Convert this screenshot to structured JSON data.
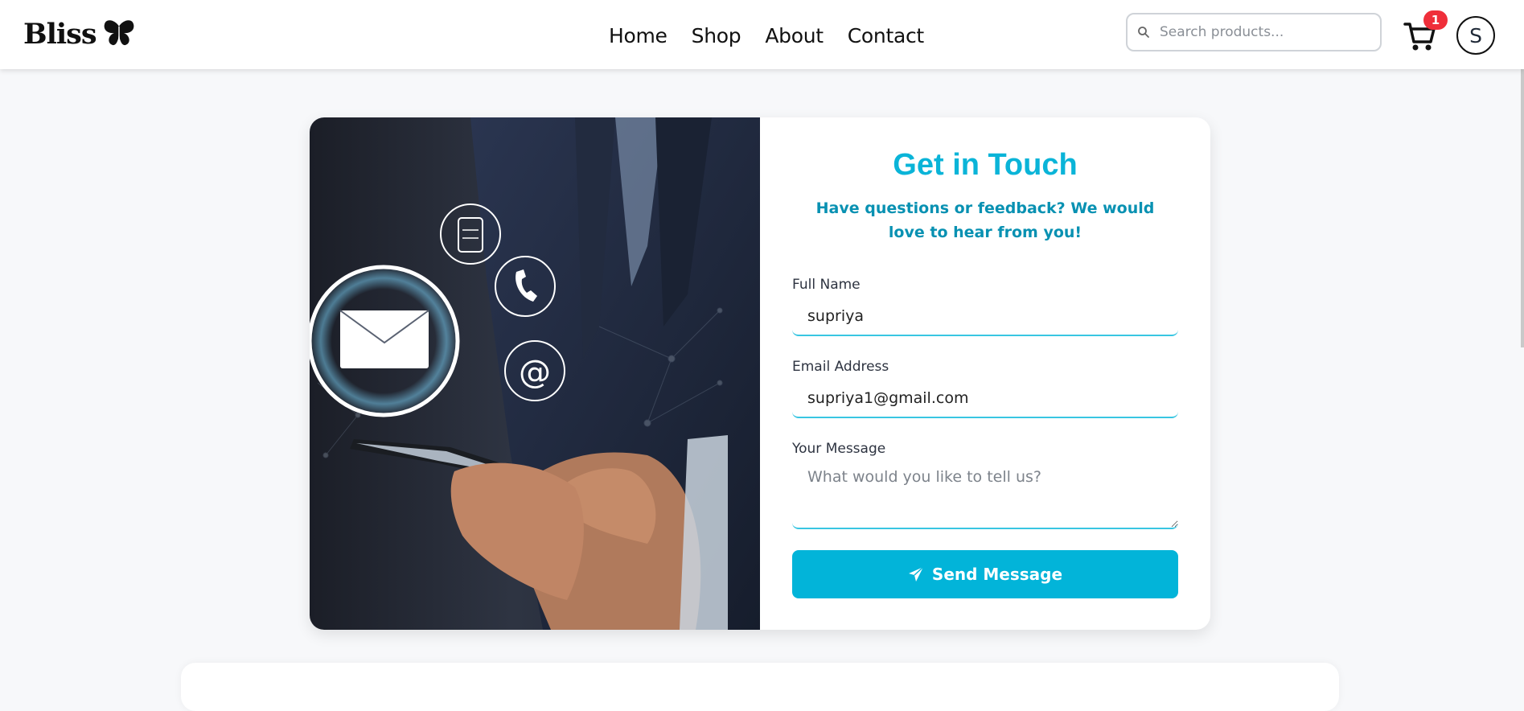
{
  "nav": {
    "brand": "Bliss",
    "links": [
      "Home",
      "Shop",
      "About",
      "Contact"
    ],
    "search_placeholder": "Search products...",
    "cart_count": "1",
    "avatar_letter": "S"
  },
  "contact": {
    "title": "Get in Touch",
    "subtitle": "Have questions or feedback? We would love to hear from you!",
    "name_label": "Full Name",
    "name_value": "supriya",
    "email_label": "Email Address",
    "email_value": "supriya1@gmail.com",
    "message_label": "Your Message",
    "message_placeholder": "What would you like to tell us?",
    "send_label": "Send Message"
  },
  "colors": {
    "accent": "#02b4d9",
    "heading": "#0ab4d8",
    "badge": "#ef2f3a"
  },
  "icons": [
    "butterfly-icon",
    "search-icon",
    "cart-icon",
    "paper-plane-icon"
  ]
}
